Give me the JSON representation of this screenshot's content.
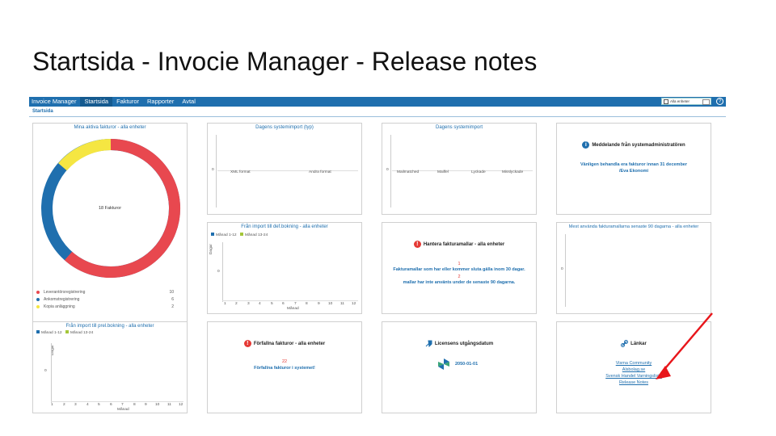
{
  "slide_title": "Startsida  - Invocie Manager - Release notes",
  "topbar": {
    "brand": "Invoice Manager",
    "nav": [
      "Startsida",
      "Fakturor",
      "Rapporter",
      "Avtal"
    ],
    "unit_select": "Alla enheter",
    "help": "?"
  },
  "breadcrumb": "Startsida",
  "panels": {
    "active_invoices": {
      "title": "Mina aktiva fakturor - alla enheter",
      "center_label": "18 Fakturor",
      "legend": [
        {
          "label": "Leverantörsregistrering",
          "value": "10",
          "color": "#e8484f"
        },
        {
          "label": "Ankomstregistrering",
          "value": "6",
          "color": "#1f6fae"
        },
        {
          "label": "Kopia anläggning",
          "value": "2",
          "color": "#f5e642"
        }
      ]
    },
    "system_import_type": {
      "title": "Dagens systemimport (typ)",
      "zero": "0",
      "categories": [
        "XML format",
        "Andra format"
      ]
    },
    "system_import": {
      "title": "Dagens systemimport",
      "zero": "0",
      "categories": [
        "Mailmatched",
        "Mailfel",
        "Lyckade",
        "Misslyckade"
      ]
    },
    "admin_message": {
      "icon_label": "i",
      "heading": "Meddelande från systemadministratören",
      "line1": "Vänligen behandla era fakturor innan 31 december",
      "line2": "/Eva Ekonomi"
    },
    "import_to_def": {
      "title": "Från import till def.bokning - alla enheter",
      "legend": [
        "Månad 1-12",
        "Månad 13-24"
      ],
      "y_label": "Dagar",
      "zero": "0",
      "x_ticks": [
        "1",
        "2",
        "3",
        "4",
        "5",
        "6",
        "7",
        "8",
        "9",
        "10",
        "11",
        "12"
      ],
      "x_label": "Månad"
    },
    "invoice_templates": {
      "icon_label": "!",
      "heading": "Hantera fakturamallar - alla enheter",
      "count1": "1",
      "line1": "Fakturamallar som har eller kommer sluta gälla inom 30 dagar.",
      "count2": "2",
      "line2": "mallar har inte använts under de senaste 90 dagarna."
    },
    "most_used_templates": {
      "title": "Mest använda fakturamallarna senaste 90 dagarna - alla enheter",
      "zero": "0"
    },
    "import_to_prel": {
      "title": "Från import till prel.bokning - alla enheter",
      "legend": [
        "Månad 1-12",
        "Månad 13-24"
      ],
      "y_label": "Dagar",
      "zero": "0",
      "x_ticks": [
        "1",
        "2",
        "3",
        "4",
        "5",
        "6",
        "7",
        "8",
        "9",
        "10",
        "11",
        "12"
      ],
      "x_label": "Månad"
    },
    "overdue_invoices": {
      "icon_label": "!",
      "heading": "Förfallna fakturor - alla enheter",
      "count": "22",
      "line": "Förfallna fakturor i systemet!"
    },
    "license": {
      "heading": "Licensens utgångsdatum",
      "date": "2050-01-01"
    },
    "links": {
      "heading": "Länkar",
      "items": [
        "Visma Community",
        "Alsbolag.se",
        "Svensk Handel Varningslista",
        "Release Notes"
      ]
    }
  },
  "colors": {
    "accent": "#1f6fae",
    "donut_red": "#e8484f",
    "donut_blue": "#1f6fae",
    "donut_yellow": "#f5e642",
    "legend_green": "#a4c639",
    "alert_red": "#e53935",
    "arrow_red": "#e8161b"
  }
}
